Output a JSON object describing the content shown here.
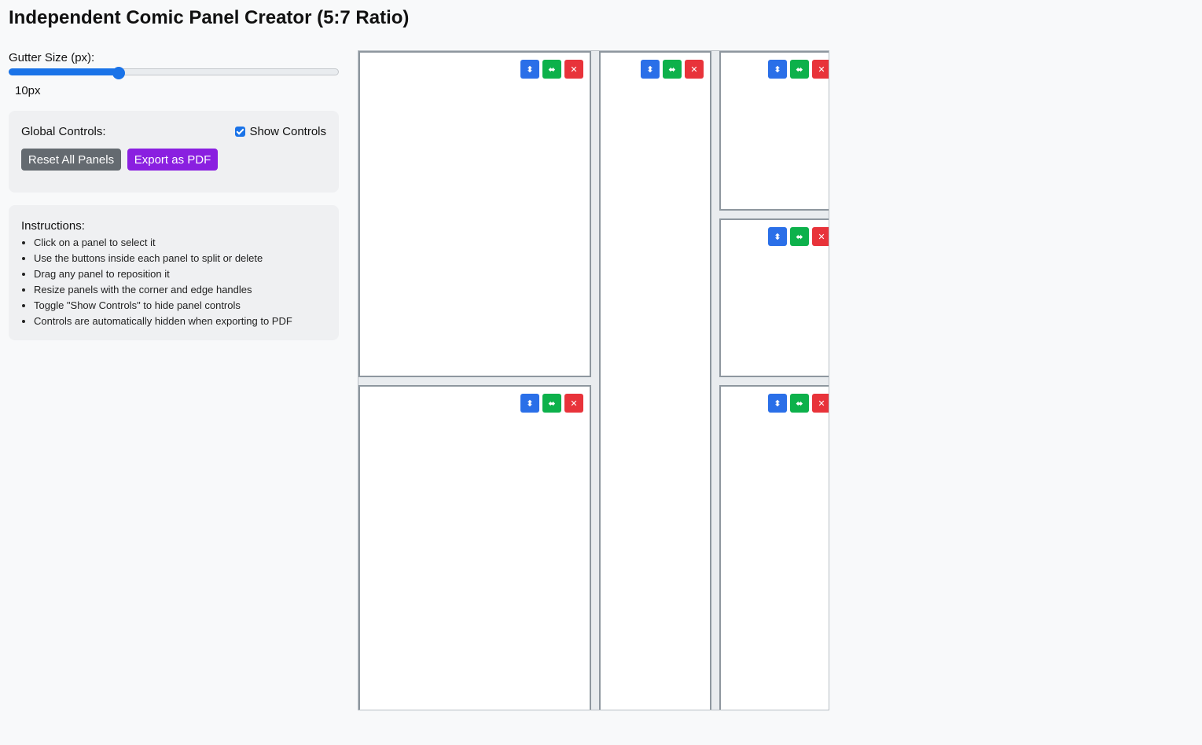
{
  "app": {
    "title": "Independent Comic Panel Creator (5:7 Ratio)"
  },
  "gutter": {
    "label": "Gutter Size (px):",
    "value": 10,
    "min": 0,
    "max": 30,
    "display": "10px"
  },
  "global_controls": {
    "label": "Global Controls:",
    "show_controls_label": "Show Controls",
    "show_controls_checked": true,
    "reset_label": "Reset All Panels",
    "export_label": "Export as PDF"
  },
  "instructions": {
    "title": "Instructions:",
    "items": [
      "Click on a panel to select it",
      "Use the buttons inside each panel to split or delete",
      "Drag any panel to reposition it",
      "Resize panels with the corner and edge handles",
      "Toggle \"Show Controls\" to hide panel controls",
      "Controls are automatically hidden when exporting to PDF"
    ]
  },
  "panel_controls": {
    "split_vertical_icon": "⬍",
    "split_horizontal_icon": "⬌",
    "delete_icon": "✕"
  },
  "colors": {
    "split_vertical": "#2a6fe8",
    "split_horizontal": "#0db14b",
    "delete": "#e8333a",
    "export_button": "#8a1fe0",
    "reset_button": "#646a70"
  }
}
